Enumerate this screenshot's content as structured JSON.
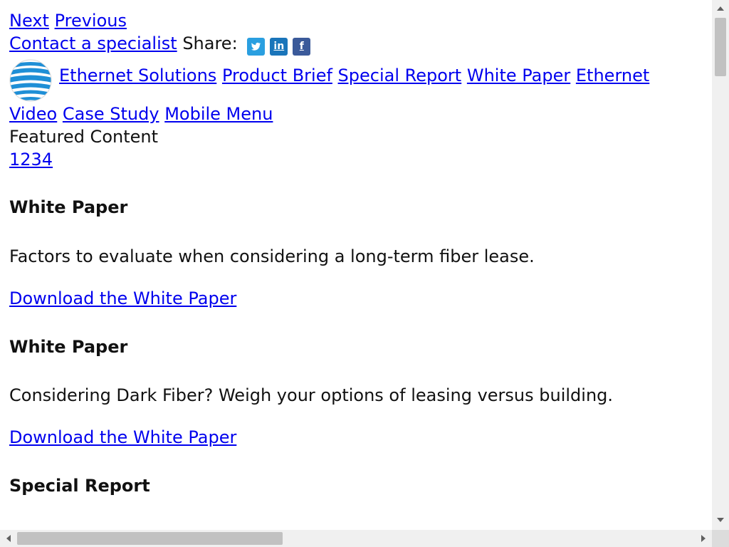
{
  "nav": {
    "next": "Next",
    "previous": "Previous",
    "contact": "Contact a specialist",
    "share_label": "Share:"
  },
  "social": {
    "twitter": "twitter-icon",
    "linkedin": "linkedin-icon",
    "facebook": "facebook-icon",
    "linkedin_glyph": "in",
    "facebook_glyph": "f",
    "twitter_glyph": "t"
  },
  "menu": {
    "items": [
      "Ethernet Solutions",
      "Product Brief",
      "Special Report",
      "White Paper",
      "Ethernet"
    ],
    "items2": [
      "Video",
      "Case Study",
      "Mobile Menu"
    ]
  },
  "featured": {
    "label": "Featured Content",
    "pager": "1234"
  },
  "articles": [
    {
      "type": "White Paper",
      "summary": "Factors to evaluate when considering a long-term fiber lease.",
      "cta": "Download the White Paper"
    },
    {
      "type": "White Paper",
      "summary": "Considering Dark Fiber? Weigh your options of leasing versus building.",
      "cta": "Download the White Paper"
    },
    {
      "type": "Special Report"
    }
  ],
  "colors": {
    "link": "#0000ee",
    "logo_blue": "#1f8fd6"
  }
}
